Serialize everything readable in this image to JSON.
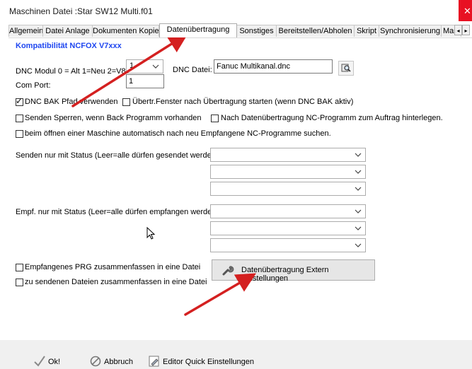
{
  "window": {
    "title": "Maschinen Datei :Star SW12 Multi.f01",
    "close_glyph": "✕"
  },
  "tabs": [
    {
      "label": "Allgemein"
    },
    {
      "label": "Datei Anlage"
    },
    {
      "label": "Dokumenten Kopie"
    },
    {
      "label": "Datenübertragung",
      "active": true
    },
    {
      "label": "Sonstiges"
    },
    {
      "label": "Bereitstellen/Abholen"
    },
    {
      "label": "Skript"
    },
    {
      "label": "Synchronisierung"
    },
    {
      "label": "Master"
    }
  ],
  "tab_scroll": {
    "left_glyph": "◂",
    "right_glyph": "▸"
  },
  "section_title": "Kompatibilität NCFOX V7xxx",
  "dnc_modul": {
    "label": "DNC Modul 0 = Alt  1=Neu 2=V8",
    "value": "1"
  },
  "com_port": {
    "label": "Com Port:",
    "value": "1"
  },
  "dnc_datei": {
    "label": "DNC Datei:",
    "value": "Fanuc Multikanal.dnc"
  },
  "checkboxes": {
    "dnc_bak": {
      "label": "DNC BAK Pfad verwenden",
      "checked": true
    },
    "uebertr_fenster": {
      "label": "Übertr.Fenster nach Übertragung starten (wenn DNC BAK aktiv)",
      "checked": false
    },
    "senden_sperren": {
      "label": "Senden Sperren, wenn Back Programm vorhanden",
      "checked": false
    },
    "nach_datenuebertragung": {
      "label": "Nach Datenübertragung NC-Programm zum Auftrag hinterlegen.",
      "checked": false
    },
    "beim_oeffnen": {
      "label": "beim öffnen einer Maschine automatisch nach neu Empfangene NC-Programme suchen.",
      "checked": false
    },
    "empf_prg": {
      "label": "Empfangenes PRG zusammenfassen in eine Datei",
      "checked": false
    },
    "zu_senden": {
      "label": "zu sendenen Dateien zusammenfassen in eine Datei",
      "checked": false
    }
  },
  "senden_status": {
    "label": "Senden nur mit Status (Leer=alle dürfen gesendet werden):"
  },
  "empf_status": {
    "label": "Empf. nur mit Status (Leer=alle dürfen empfangen werden):"
  },
  "extern_button": {
    "label": "Datenübertragung Extern Einstellungen"
  },
  "bottom": {
    "ok": "Ok!",
    "abbruch": "Abbruch",
    "editor": "Editor Quick Einstellungen"
  },
  "colors": {
    "accent_title": "#1e46f0",
    "annotation_arrow": "#d42020",
    "close": "#e81123"
  },
  "icons": [
    "close-icon",
    "chevron-down-icon",
    "browse-folder-icon",
    "wrench-icon",
    "checkmark-icon",
    "cancel-icon",
    "editor-icon",
    "mouse-cursor-icon",
    "red-arrow-annotation"
  ]
}
